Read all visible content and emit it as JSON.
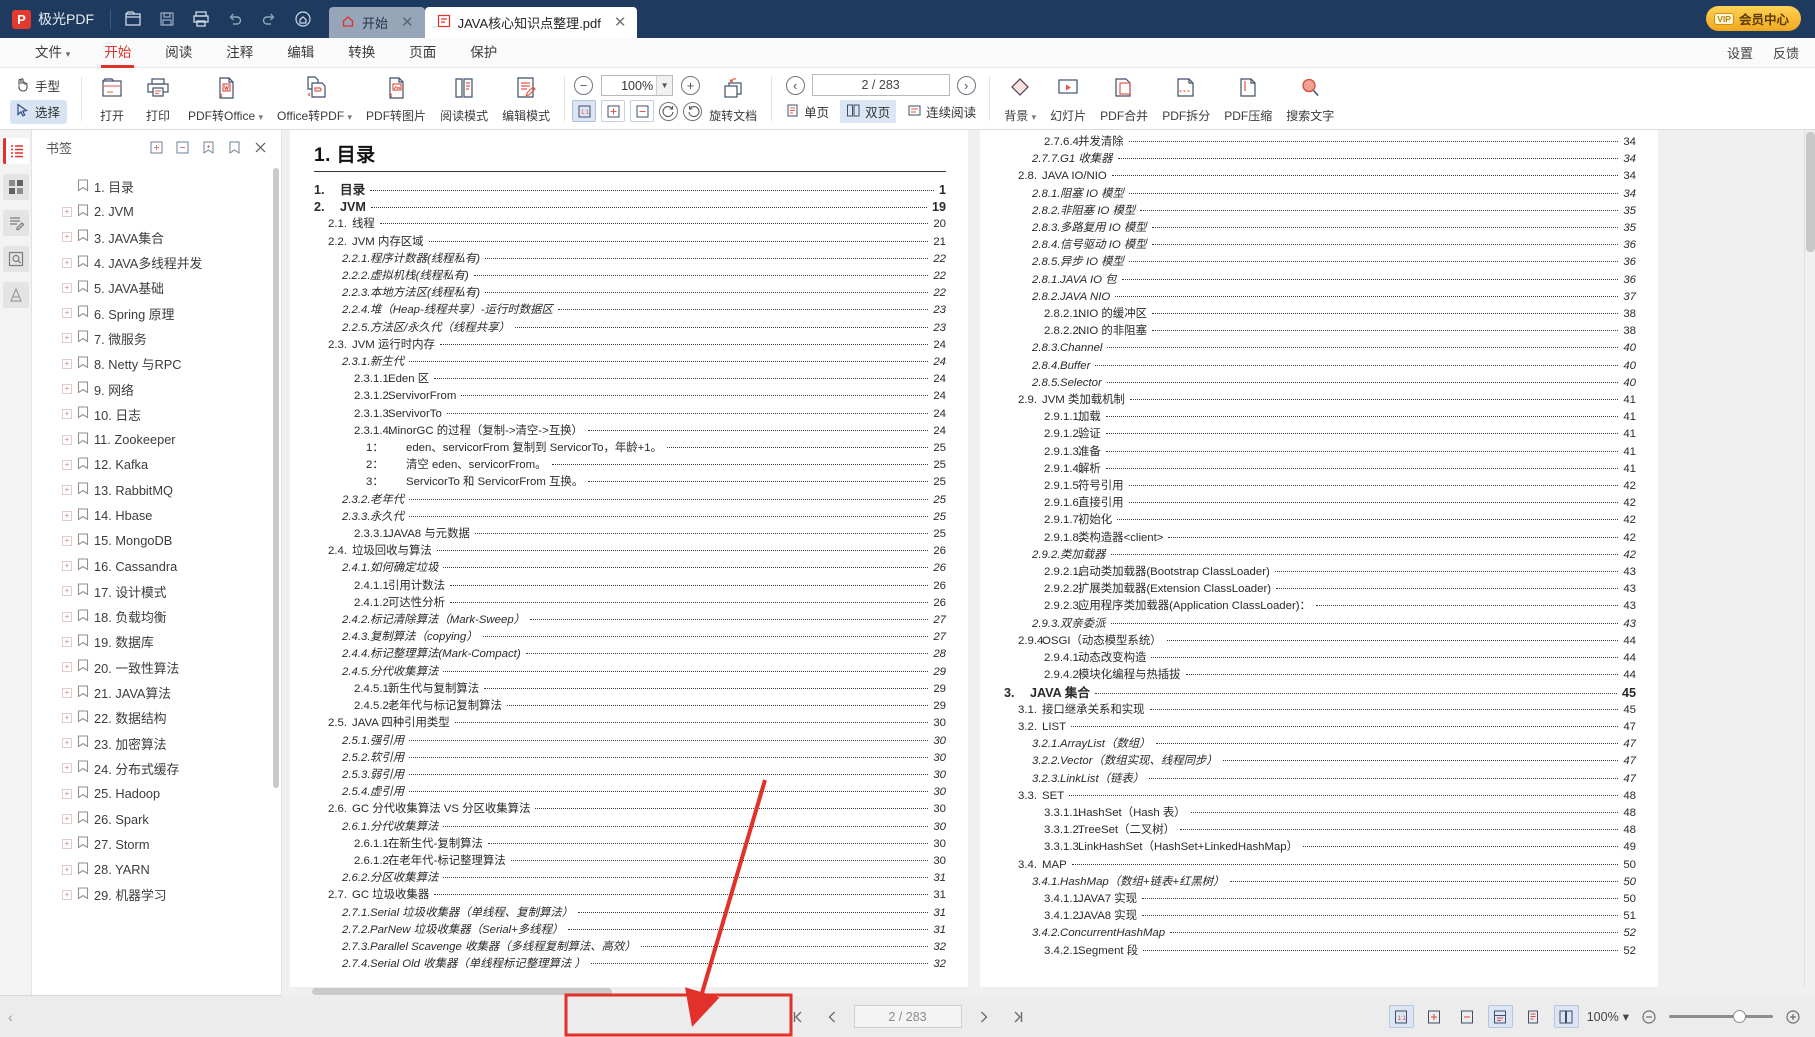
{
  "app": {
    "brand": "极光PDF",
    "logo_letter": "P",
    "vip_label": "会员中心",
    "vip_tag": "VIP",
    "accent_red": "#e2302a",
    "titlebar_bg": "#1e3a5f"
  },
  "titlebar_icons": [
    {
      "name": "open-file-icon",
      "label": "打开"
    },
    {
      "name": "save-icon",
      "label": "保存"
    },
    {
      "name": "print-icon",
      "label": "打印"
    },
    {
      "name": "undo-icon",
      "label": "撤销"
    },
    {
      "name": "redo-icon",
      "label": "重做"
    },
    {
      "name": "home-circle-icon",
      "label": "主页"
    }
  ],
  "tabs": [
    {
      "label": "开始",
      "icon": "home-icon",
      "active": false,
      "closable": true
    },
    {
      "label": "JAVA核心知识点整理.pdf",
      "icon": "pdf-file-icon",
      "active": true,
      "closable": true
    }
  ],
  "menu": {
    "items": [
      {
        "label": "文件",
        "caret": true,
        "active": false
      },
      {
        "label": "开始",
        "caret": false,
        "active": true
      },
      {
        "label": "阅读",
        "caret": false,
        "active": false
      },
      {
        "label": "注释",
        "caret": false,
        "active": false
      },
      {
        "label": "编辑",
        "caret": false,
        "active": false
      },
      {
        "label": "转换",
        "caret": false,
        "active": false
      },
      {
        "label": "页面",
        "caret": false,
        "active": false
      },
      {
        "label": "保护",
        "caret": false,
        "active": false
      }
    ],
    "right": [
      {
        "label": "设置"
      },
      {
        "label": "反馈"
      }
    ]
  },
  "ribbon": {
    "mode_hand": "手型",
    "mode_select": "选择",
    "buttons": [
      {
        "label": "打开",
        "icon": "open-folder-icon",
        "caret": false
      },
      {
        "label": "打印",
        "icon": "printer-icon",
        "caret": false
      },
      {
        "label": "PDF转Office",
        "icon": "pdf-to-word-icon",
        "caret": true
      },
      {
        "label": "Office转PDF",
        "icon": "office-to-pdf-icon",
        "caret": true
      },
      {
        "label": "PDF转图片",
        "icon": "pdf-to-image-icon",
        "caret": false
      },
      {
        "label": "阅读模式",
        "icon": "read-mode-icon",
        "caret": false
      },
      {
        "label": "编辑模式",
        "icon": "edit-mode-icon",
        "caret": false
      }
    ],
    "zoom": {
      "value": "100%",
      "minus": "−",
      "plus": "+",
      "fit_actual": "1:1",
      "fit_page": "适合页面",
      "fit_width": "适合宽度",
      "rotate_left": "向左旋转",
      "rotate_right": "向右旋转",
      "rotate_doc": "旋转文档"
    },
    "pagenav": {
      "value": "2 / 283",
      "prev": "上一页",
      "next": "下一页"
    },
    "viewmodes": [
      {
        "label": "单页",
        "icon": "single-page-icon",
        "active": false
      },
      {
        "label": "双页",
        "icon": "dual-page-icon",
        "active": true
      },
      {
        "label": "连续阅读",
        "icon": "continuous-scroll-icon",
        "active": false
      }
    ],
    "right_buttons": [
      {
        "label": "背景",
        "icon": "background-icon",
        "caret": true
      },
      {
        "label": "幻灯片",
        "icon": "slideshow-icon",
        "caret": false
      },
      {
        "label": "PDF合并",
        "icon": "pdf-merge-icon",
        "caret": false
      },
      {
        "label": "PDF拆分",
        "icon": "pdf-split-icon",
        "caret": false
      },
      {
        "label": "PDF压缩",
        "icon": "pdf-compress-icon",
        "caret": false
      },
      {
        "label": "搜索文字",
        "icon": "search-text-icon",
        "caret": false
      }
    ]
  },
  "rail": [
    {
      "name": "bookmarks-rail-icon",
      "active": true
    },
    {
      "name": "thumbnails-rail-icon",
      "active": false
    },
    {
      "name": "annotations-rail-icon",
      "active": false
    },
    {
      "name": "search-rail-icon",
      "active": false
    },
    {
      "name": "signature-rail-icon",
      "active": false
    }
  ],
  "bookmarks": {
    "title": "书签",
    "header_icons": [
      {
        "name": "expand-all-icon"
      },
      {
        "name": "collapse-all-icon"
      },
      {
        "name": "add-bookmark-icon"
      },
      {
        "name": "remove-bookmark-icon"
      },
      {
        "name": "close-panel-icon"
      }
    ],
    "items": [
      {
        "label": "1. 目录",
        "expandable": false
      },
      {
        "label": "2. JVM",
        "expandable": true
      },
      {
        "label": "3. JAVA集合",
        "expandable": true
      },
      {
        "label": "4. JAVA多线程并发",
        "expandable": true
      },
      {
        "label": "5. JAVA基础",
        "expandable": true
      },
      {
        "label": "6. Spring 原理",
        "expandable": true
      },
      {
        "label": "7.  微服务",
        "expandable": true
      },
      {
        "label": "8. Netty 与RPC",
        "expandable": true
      },
      {
        "label": "9. 网络",
        "expandable": true
      },
      {
        "label": "10. 日志",
        "expandable": true
      },
      {
        "label": "11. Zookeeper",
        "expandable": true
      },
      {
        "label": "12. Kafka",
        "expandable": true
      },
      {
        "label": "13. RabbitMQ",
        "expandable": true
      },
      {
        "label": "14. Hbase",
        "expandable": true
      },
      {
        "label": "15. MongoDB",
        "expandable": true
      },
      {
        "label": "16. Cassandra",
        "expandable": true
      },
      {
        "label": "17. 设计模式",
        "expandable": true
      },
      {
        "label": "18. 负载均衡",
        "expandable": true
      },
      {
        "label": "19. 数据库",
        "expandable": true
      },
      {
        "label": "20. 一致性算法",
        "expandable": true
      },
      {
        "label": "21. JAVA算法",
        "expandable": true
      },
      {
        "label": "22. 数据结构",
        "expandable": true
      },
      {
        "label": "23. 加密算法",
        "expandable": true
      },
      {
        "label": "24. 分布式缓存",
        "expandable": true
      },
      {
        "label": "25. Hadoop",
        "expandable": true
      },
      {
        "label": "26. Spark",
        "expandable": true
      },
      {
        "label": "27. Storm",
        "expandable": true
      },
      {
        "label": "28. YARN",
        "expandable": true
      },
      {
        "label": "29. 机器学习",
        "expandable": true
      }
    ]
  },
  "document": {
    "left_page": {
      "heading": "1. 目录",
      "entries": [
        {
          "lv": 1,
          "num": "1.",
          "title": "目录",
          "page": "1"
        },
        {
          "lv": 1,
          "num": "2.",
          "title": "JVM",
          "page": "19"
        },
        {
          "lv": 2,
          "num": "2.1.",
          "title": "线程",
          "page": "20"
        },
        {
          "lv": 2,
          "num": "2.2.",
          "title": "JVM 内存区域",
          "page": "21"
        },
        {
          "lv": 3,
          "num": "2.2.1.",
          "title": "程序计数器(线程私有)",
          "page": "22"
        },
        {
          "lv": 3,
          "num": "2.2.2.",
          "title": "虚拟机栈(线程私有)",
          "page": "22"
        },
        {
          "lv": 3,
          "num": "2.2.3.",
          "title": "本地方法区(线程私有)",
          "page": "22"
        },
        {
          "lv": 3,
          "num": "2.2.4.",
          "title": "堆（Heap-线程共享）-运行时数据区",
          "page": "23"
        },
        {
          "lv": 3,
          "num": "2.2.5.",
          "title": "方法区/永久代（线程共享）",
          "page": "23"
        },
        {
          "lv": 2,
          "num": "2.3.",
          "title": "JVM 运行时内存",
          "page": "24"
        },
        {
          "lv": 3,
          "num": "2.3.1.",
          "title": "新生代",
          "page": "24"
        },
        {
          "lv": 4,
          "num": "2.3.1.1.",
          "title": "Eden 区",
          "page": "24"
        },
        {
          "lv": 4,
          "num": "2.3.1.2.",
          "title": "ServivorFrom",
          "page": "24"
        },
        {
          "lv": 4,
          "num": "2.3.1.3.",
          "title": "ServivorTo",
          "page": "24"
        },
        {
          "lv": 4,
          "num": "2.3.1.4.",
          "title": "MinorGC 的过程（复制->清空->互换）",
          "page": "24"
        },
        {
          "lv": 5,
          "num": "1：",
          "title": "eden、servicorFrom 复制到 ServicorTo，年龄+1。",
          "page": "25"
        },
        {
          "lv": 5,
          "num": "2：",
          "title": "清空 eden、servicorFrom。",
          "page": "25"
        },
        {
          "lv": 5,
          "num": "3：",
          "title": "ServicorTo 和 ServicorFrom 互换。",
          "page": "25"
        },
        {
          "lv": 3,
          "num": "2.3.2.",
          "title": "老年代",
          "page": "25"
        },
        {
          "lv": 3,
          "num": "2.3.3.",
          "title": "永久代",
          "page": "25"
        },
        {
          "lv": 4,
          "num": "2.3.3.1.",
          "title": "JAVA8 与元数据",
          "page": "25"
        },
        {
          "lv": 2,
          "num": "2.4.",
          "title": "垃圾回收与算法",
          "page": "26"
        },
        {
          "lv": 3,
          "num": "2.4.1.",
          "title": "如何确定垃圾",
          "page": "26"
        },
        {
          "lv": 4,
          "num": "2.4.1.1.",
          "title": "引用计数法",
          "page": "26"
        },
        {
          "lv": 4,
          "num": "2.4.1.2.",
          "title": "可达性分析",
          "page": "26"
        },
        {
          "lv": 3,
          "num": "2.4.2.",
          "title": "标记清除算法（Mark-Sweep）",
          "page": "27"
        },
        {
          "lv": 3,
          "num": "2.4.3.",
          "title": "复制算法（copying）",
          "page": "27"
        },
        {
          "lv": 3,
          "num": "2.4.4.",
          "title": "标记整理算法(Mark-Compact)",
          "page": "28"
        },
        {
          "lv": 3,
          "num": "2.4.5.",
          "title": "分代收集算法",
          "page": "29"
        },
        {
          "lv": 4,
          "num": "2.4.5.1.",
          "title": "新生代与复制算法",
          "page": "29"
        },
        {
          "lv": 4,
          "num": "2.4.5.2.",
          "title": "老年代与标记复制算法",
          "page": "29"
        },
        {
          "lv": 2,
          "num": "2.5.",
          "title": "JAVA 四种引用类型",
          "page": "30"
        },
        {
          "lv": 3,
          "num": "2.5.1.",
          "title": "强引用",
          "page": "30"
        },
        {
          "lv": 3,
          "num": "2.5.2.",
          "title": "软引用",
          "page": "30"
        },
        {
          "lv": 3,
          "num": "2.5.3.",
          "title": "弱引用",
          "page": "30"
        },
        {
          "lv": 3,
          "num": "2.5.4.",
          "title": "虚引用",
          "page": "30"
        },
        {
          "lv": 2,
          "num": "2.6.",
          "title": "GC 分代收集算法 VS 分区收集算法",
          "page": "30"
        },
        {
          "lv": 3,
          "num": "2.6.1.",
          "title": "分代收集算法",
          "page": "30"
        },
        {
          "lv": 4,
          "num": "2.6.1.1.",
          "title": "在新生代-复制算法",
          "page": "30"
        },
        {
          "lv": 4,
          "num": "2.6.1.2.",
          "title": "在老年代-标记整理算法",
          "page": "30"
        },
        {
          "lv": 3,
          "num": "2.6.2.",
          "title": "分区收集算法",
          "page": "31"
        },
        {
          "lv": 2,
          "num": "2.7.",
          "title": "GC 垃圾收集器",
          "page": "31"
        },
        {
          "lv": 3,
          "num": "2.7.1.",
          "title": "Serial 垃圾收集器（单线程、复制算法）",
          "page": "31"
        },
        {
          "lv": 3,
          "num": "2.7.2.",
          "title": "ParNew 垃圾收集器（Serial+多线程）",
          "page": "31"
        },
        {
          "lv": 3,
          "num": "2.7.3.",
          "title": "Parallel Scavenge 收集器（多线程复制算法、高效）",
          "page": "32"
        },
        {
          "lv": 3,
          "num": "2.7.4.",
          "title": "Serial Old 收集器（单线程标记整理算法 ）",
          "page": "32"
        }
      ]
    },
    "right_page": {
      "entries": [
        {
          "lv": 4,
          "num": "2.7.6.4.",
          "title": "并发清除",
          "page": "34"
        },
        {
          "lv": 3,
          "num": "2.7.7.",
          "title": "G1 收集器",
          "page": "34"
        },
        {
          "lv": 2,
          "num": "2.8.",
          "title": "JAVA IO/NIO",
          "page": "34"
        },
        {
          "lv": 3,
          "num": "2.8.1.",
          "title": "阻塞 IO 模型",
          "page": "34"
        },
        {
          "lv": 3,
          "num": "2.8.2.",
          "title": "非阻塞 IO 模型",
          "page": "35"
        },
        {
          "lv": 3,
          "num": "2.8.3.",
          "title": "多路复用 IO 模型",
          "page": "35"
        },
        {
          "lv": 3,
          "num": "2.8.4.",
          "title": "信号驱动 IO 模型",
          "page": "36"
        },
        {
          "lv": 3,
          "num": "2.8.5.",
          "title": "异步 IO 模型",
          "page": "36"
        },
        {
          "lv": 3,
          "num": "2.8.1.",
          "title": "JAVA IO 包",
          "page": "36"
        },
        {
          "lv": 3,
          "num": "2.8.2.",
          "title": "JAVA NIO",
          "page": "37"
        },
        {
          "lv": 4,
          "num": "2.8.2.1.",
          "title": "NIO 的缓冲区",
          "page": "38"
        },
        {
          "lv": 4,
          "num": "2.8.2.2.",
          "title": "NIO 的非阻塞",
          "page": "38"
        },
        {
          "lv": 3,
          "num": "2.8.3.",
          "title": "Channel",
          "page": "40"
        },
        {
          "lv": 3,
          "num": "2.8.4.",
          "title": "Buffer",
          "page": "40"
        },
        {
          "lv": 3,
          "num": "2.8.5.",
          "title": "Selector",
          "page": "40"
        },
        {
          "lv": 2,
          "num": "2.9.",
          "title": "JVM 类加载机制",
          "page": "41"
        },
        {
          "lv": 4,
          "num": "2.9.1.1.",
          "title": "加载",
          "page": "41"
        },
        {
          "lv": 4,
          "num": "2.9.1.2.",
          "title": "验证",
          "page": "41"
        },
        {
          "lv": 4,
          "num": "2.9.1.3.",
          "title": "准备",
          "page": "41"
        },
        {
          "lv": 4,
          "num": "2.9.1.4.",
          "title": "解析",
          "page": "41"
        },
        {
          "lv": 4,
          "num": "2.9.1.5.",
          "title": "符号引用",
          "page": "42"
        },
        {
          "lv": 4,
          "num": "2.9.1.6.",
          "title": "直接引用",
          "page": "42"
        },
        {
          "lv": 4,
          "num": "2.9.1.7.",
          "title": "初始化",
          "page": "42"
        },
        {
          "lv": 4,
          "num": "2.9.1.8.",
          "title": "类构造器<client>",
          "page": "42"
        },
        {
          "lv": 3,
          "num": "2.9.2.",
          "title": "类加载器",
          "page": "42"
        },
        {
          "lv": 4,
          "num": "2.9.2.1.",
          "title": "启动类加载器(Bootstrap ClassLoader)",
          "page": "43"
        },
        {
          "lv": 4,
          "num": "2.9.2.2.",
          "title": "扩展类加载器(Extension ClassLoader)",
          "page": "43"
        },
        {
          "lv": 4,
          "num": "2.9.2.3.",
          "title": "应用程序类加载器(Application ClassLoader)：",
          "page": "43"
        },
        {
          "lv": 3,
          "num": "2.9.3.",
          "title": "双亲委派",
          "page": "43"
        },
        {
          "lv": 2,
          "num": "2.9.4.",
          "title": "OSGI（动态模型系统）",
          "page": "44"
        },
        {
          "lv": 4,
          "num": "2.9.4.1.",
          "title": "动态改变构造",
          "page": "44"
        },
        {
          "lv": 4,
          "num": "2.9.4.2.",
          "title": "模块化编程与热插拔",
          "page": "44"
        },
        {
          "lv": 1,
          "num": "3.",
          "title": "JAVA 集合",
          "page": "45"
        },
        {
          "lv": 2,
          "num": "3.1.",
          "title": "接口继承关系和实现",
          "page": "45"
        },
        {
          "lv": 2,
          "num": "3.2.",
          "title": "LIST",
          "page": "47"
        },
        {
          "lv": 3,
          "num": "3.2.1.",
          "title": "ArrayList（数组）",
          "page": "47"
        },
        {
          "lv": 3,
          "num": "3.2.2.",
          "title": "Vector（数组实现、线程同步）",
          "page": "47"
        },
        {
          "lv": 3,
          "num": "3.2.3.",
          "title": "LinkList（链表）",
          "page": "47"
        },
        {
          "lv": 2,
          "num": "3.3.",
          "title": "SET",
          "page": "48"
        },
        {
          "lv": 4,
          "num": "3.3.1.1.",
          "title": "HashSet（Hash 表）",
          "page": "48"
        },
        {
          "lv": 4,
          "num": "3.3.1.2.",
          "title": "TreeSet（二叉树）",
          "page": "48"
        },
        {
          "lv": 4,
          "num": "3.3.1.3.",
          "title": "LinkHashSet（HashSet+LinkedHashMap）",
          "page": "49"
        },
        {
          "lv": 2,
          "num": "3.4.",
          "title": "MAP",
          "page": "50"
        },
        {
          "lv": 3,
          "num": "3.4.1.",
          "title": "HashMap（数组+链表+红黑树）",
          "page": "50"
        },
        {
          "lv": 4,
          "num": "3.4.1.1.",
          "title": "JAVA7 实现",
          "page": "50"
        },
        {
          "lv": 4,
          "num": "3.4.1.2.",
          "title": "JAVA8 实现",
          "page": "51"
        },
        {
          "lv": 3,
          "num": "3.4.2.",
          "title": "ConcurrentHashMap",
          "page": "52"
        },
        {
          "lv": 4,
          "num": "3.4.2.1.",
          "title": "Segment 段",
          "page": "52"
        }
      ]
    }
  },
  "bottombar": {
    "page_value": "2 / 283",
    "first_page": "首页",
    "prev_page": "上一页",
    "next_page": "下一页",
    "last_page": "末页",
    "zoom_value": "100%",
    "view_icons": [
      {
        "name": "actual-size-icon",
        "active": true
      },
      {
        "name": "fit-page-icon",
        "active": false
      },
      {
        "name": "fit-width-icon",
        "active": false
      },
      {
        "name": "continuous-view-icon",
        "active": true
      },
      {
        "name": "single-view-icon",
        "active": false
      },
      {
        "name": "dual-view-icon",
        "active": true
      }
    ]
  }
}
